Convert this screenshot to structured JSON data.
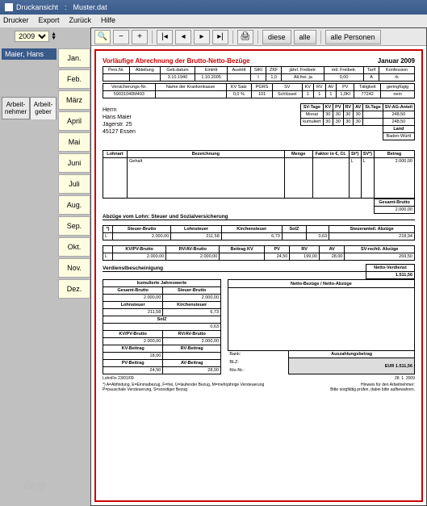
{
  "window": {
    "title": "Druckansicht",
    "file": "Muster.dat"
  },
  "menu": [
    "Drucker",
    "Export",
    "Zurück",
    "Hilfe"
  ],
  "year": "2009",
  "person": "Maier, Hans",
  "tabs": {
    "left": "Arbeit-\nnehmer",
    "right": "Arbeit-\ngeber"
  },
  "months": [
    "Jan.",
    "Feb.",
    "März",
    "April",
    "Mai",
    "Juni",
    "Juli",
    "Aug.",
    "Sep.",
    "Okt.",
    "Nov.",
    "Dez."
  ],
  "toolbar": {
    "diese": "diese",
    "alle": "alle",
    "alle_personen": "alle Personen"
  },
  "doc": {
    "title": "Vorläufige Abrechnung der Brutto-Netto-Bezüge",
    "month": "Januar 2009",
    "head": {
      "labels": [
        "Pers.Nr.",
        "Abteilung",
        "Geb.datum",
        "Eintritt",
        "Austritt",
        "StKl",
        "ZKF",
        "jährl. Freibetr.",
        "mtl. Freibetr.",
        "Tarif",
        "Konfession"
      ],
      "values": [
        "",
        "",
        "3.10.1940",
        "1.10.2005",
        "",
        "I",
        "1,0",
        "Alt.frei. ja",
        "0,00",
        "A",
        "rk"
      ],
      "labels2": [
        "Versicherungs-Nr.",
        "Name der Krankenkasse",
        "KV Satz",
        "PGRS",
        "SV",
        "KV",
        "RV",
        "AV",
        "PV",
        "Tätigkeit",
        "geringfügig"
      ],
      "values2": [
        "59031040M493",
        "",
        "0,0 %",
        "101",
        "Schlüssel",
        "1",
        "1",
        "1",
        "1,0KI",
        "77242",
        "nein"
      ]
    },
    "addr": {
      "anrede": "Herrn",
      "name": "Hans Maier",
      "street": "Jägerstr. 25",
      "city": "45127 Essen"
    },
    "sv": {
      "labels": [
        "SV-Tage",
        "KV",
        "PV",
        "RV",
        "AV",
        "St.Tage",
        "SV-AG-Anteil"
      ],
      "monat": [
        "Monat",
        "30",
        "30",
        "30",
        "30",
        "",
        "248,50"
      ],
      "kum": [
        "kumuliert",
        "30",
        "30",
        "30",
        "30",
        "",
        "248,50"
      ],
      "land_lbl": "Land",
      "land": "Baden-Württ"
    },
    "line": {
      "lohnart": "Lohnart",
      "bez": "Bezeichnung",
      "menge": "Menge",
      "faktor": "Faktor in €, Ct.",
      "st": "St*)",
      "sv": "SV*)",
      "betrag": "Betrag",
      "item": "Gehalt",
      "st_v": "L",
      "sv_v": "L",
      "val": "2.000,00"
    },
    "gesamt_brutto_lbl": "Gesamt-Brutto",
    "gesamt_brutto": "2.000,00",
    "abz_hdr": "Abzüge vom Lohn: Steuer und Sozialversicherung",
    "tax": {
      "labels": [
        "*)",
        "Steuer-Brutto",
        "Lohnsteuer",
        "Kirchensteuer",
        "SolZ",
        "",
        "Steueranteil. Abzüge"
      ],
      "vals": [
        "L",
        "2.000,00",
        "211,58",
        "6,73",
        "",
        "0,63",
        "218,94"
      ],
      "labels2": [
        "",
        "KV/PV-Brutto",
        "RV/AV-Brutto",
        "Beitrag KV",
        "PV",
        "RV",
        "AV",
        "SV-rechtl. Abzüge"
      ],
      "vals2": [
        "L",
        "2.000,00",
        "2.000,00",
        "",
        "24,50",
        "199,00",
        "28,00",
        "269,50"
      ]
    },
    "verd_hdr": "Verdienstbescheinigung",
    "netto_verd_lbl": "Netto-Verdienst",
    "netto_verd": "1.511,56",
    "kum_hdr": "kumulierte Jahreswerte",
    "left_rows": {
      "r1l": [
        "Gesamt-Brutto",
        "Steuer-Brutto"
      ],
      "r1v": [
        "2.000,00",
        "2.000,00"
      ],
      "r2l": [
        "Lohnsteuer",
        "Kirchensteuer"
      ],
      "r2v": [
        "211,58",
        "6,73"
      ],
      "r3l": "SolZ",
      "r3v": "0,63",
      "r4l": [
        "KV/PV-Brutto",
        "RV/AV-Brutto"
      ],
      "r4v": [
        "2.000,00",
        "2.000,00"
      ],
      "r5l": [
        "KV-Beitrag",
        "RV-Beitrag"
      ],
      "r5v": [
        "18,00",
        ""
      ],
      "r6l": [
        "PV-Beitrag",
        "AV-Beitrag"
      ],
      "r6v": [
        "24,50",
        "28,00"
      ]
    },
    "nba_lbl": "Netto-Bezüge / Netto-Abzüge",
    "bank": {
      "bank_lbl": "Bank:",
      "blz_lbl": "BLZ:",
      "kto_lbl": "Kto-Nr.:"
    },
    "ausz_lbl": "Auszahlungsbetrag",
    "ausz_cur": "EUR",
    "ausz_val": "1.511,56",
    "lohnfix": "LohnFix  23/01/09",
    "date_r": "28. 1. 2009",
    "foot1": "*)  A=Abfindung,  E=Einmalbezug,  F=frei,  U=laufender Bezug,  M=mehrjährige Versteuerung",
    "foot2": "P=pauschale Versteuerung,  S=sonstiger Bezug",
    "hinweis1": "Hinweis für den Arbeitnehmer:",
    "hinweis2": "Bitte sorgfältig prüfen, dabei bitte aufbewahren."
  },
  "watermark": "blog"
}
